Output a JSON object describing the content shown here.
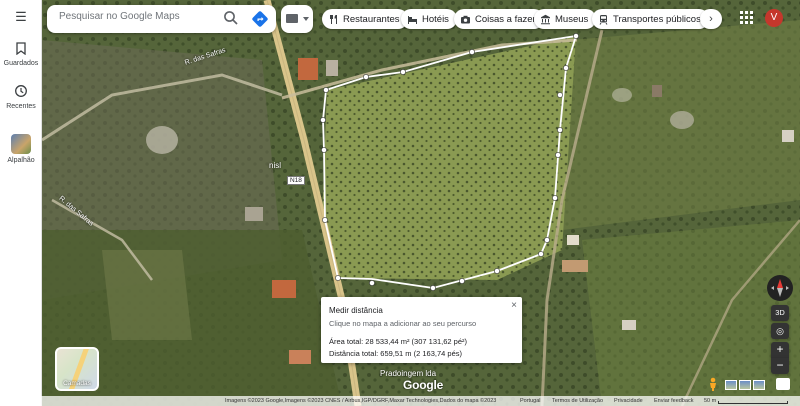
{
  "sidebar": {
    "items": [
      {
        "label": "Guardados",
        "icon": "bookmark-icon"
      },
      {
        "label": "Recentes",
        "icon": "history-icon"
      },
      {
        "label": "Alpalhão",
        "icon": "place-thumbnail"
      }
    ]
  },
  "search": {
    "placeholder": "Pesquisar no Google Maps"
  },
  "chips": [
    {
      "label": "Restaurantes",
      "icon": "restaurant-icon"
    },
    {
      "label": "Hotéis",
      "icon": "hotel-icon"
    },
    {
      "label": "Coisas a fazer",
      "icon": "camera-icon"
    },
    {
      "label": "Museus",
      "icon": "museum-icon"
    },
    {
      "label": "Transportes públicos",
      "icon": "transit-icon"
    }
  ],
  "account": {
    "initial": "V"
  },
  "measure": {
    "title": "Medir distância",
    "hint": "Clique no mapa a adicionar ao seu percurso",
    "area": "Área total: 28 533,44 m² (307 131,62 pé²)",
    "distance": "Distância total: 659,51 m (2 163,74 pés)",
    "close": "×"
  },
  "controls": {
    "three_d": "3D",
    "zoom_in": "+",
    "zoom_out": "−"
  },
  "layers_tile": {
    "label": "Camadas"
  },
  "map_labels": {
    "place_bottom": "Pradoingem lda",
    "place_mid": "nisl",
    "route": "N18",
    "street_left": "R. das Safras",
    "street_top": "R. das Safras"
  },
  "logo": "Google",
  "footer": {
    "attribution": "Imagens ©2023 Google,Imagens ©2023 CNES / Airbus,IGP/DGRF,Maxar Technologies,Dados do mapa ©2023",
    "region": "Portugal",
    "terms": "Termos de Utilização",
    "privacy": "Privacidade",
    "feedback": "Enviar feedback",
    "scale": "50 m"
  },
  "colors": {
    "avatar": "#c5372c",
    "measure_line": "#ffffff",
    "road": "#d9c48a"
  }
}
